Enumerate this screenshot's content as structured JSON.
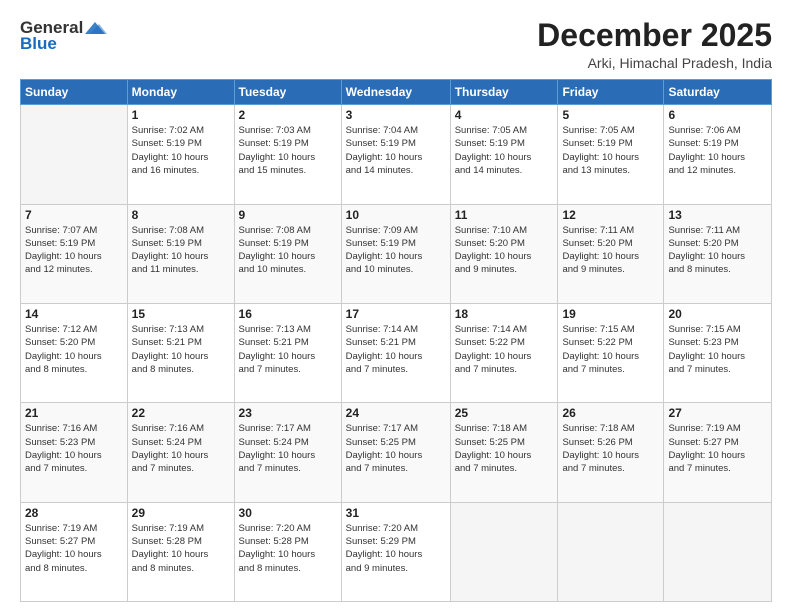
{
  "logo": {
    "general": "General",
    "blue": "Blue"
  },
  "header": {
    "month_year": "December 2025",
    "location": "Arki, Himachal Pradesh, India"
  },
  "days_of_week": [
    "Sunday",
    "Monday",
    "Tuesday",
    "Wednesday",
    "Thursday",
    "Friday",
    "Saturday"
  ],
  "weeks": [
    [
      {
        "day": "",
        "info": ""
      },
      {
        "day": "1",
        "info": "Sunrise: 7:02 AM\nSunset: 5:19 PM\nDaylight: 10 hours\nand 16 minutes."
      },
      {
        "day": "2",
        "info": "Sunrise: 7:03 AM\nSunset: 5:19 PM\nDaylight: 10 hours\nand 15 minutes."
      },
      {
        "day": "3",
        "info": "Sunrise: 7:04 AM\nSunset: 5:19 PM\nDaylight: 10 hours\nand 14 minutes."
      },
      {
        "day": "4",
        "info": "Sunrise: 7:05 AM\nSunset: 5:19 PM\nDaylight: 10 hours\nand 14 minutes."
      },
      {
        "day": "5",
        "info": "Sunrise: 7:05 AM\nSunset: 5:19 PM\nDaylight: 10 hours\nand 13 minutes."
      },
      {
        "day": "6",
        "info": "Sunrise: 7:06 AM\nSunset: 5:19 PM\nDaylight: 10 hours\nand 12 minutes."
      }
    ],
    [
      {
        "day": "7",
        "info": "Sunrise: 7:07 AM\nSunset: 5:19 PM\nDaylight: 10 hours\nand 12 minutes."
      },
      {
        "day": "8",
        "info": "Sunrise: 7:08 AM\nSunset: 5:19 PM\nDaylight: 10 hours\nand 11 minutes."
      },
      {
        "day": "9",
        "info": "Sunrise: 7:08 AM\nSunset: 5:19 PM\nDaylight: 10 hours\nand 10 minutes."
      },
      {
        "day": "10",
        "info": "Sunrise: 7:09 AM\nSunset: 5:19 PM\nDaylight: 10 hours\nand 10 minutes."
      },
      {
        "day": "11",
        "info": "Sunrise: 7:10 AM\nSunset: 5:20 PM\nDaylight: 10 hours\nand 9 minutes."
      },
      {
        "day": "12",
        "info": "Sunrise: 7:11 AM\nSunset: 5:20 PM\nDaylight: 10 hours\nand 9 minutes."
      },
      {
        "day": "13",
        "info": "Sunrise: 7:11 AM\nSunset: 5:20 PM\nDaylight: 10 hours\nand 8 minutes."
      }
    ],
    [
      {
        "day": "14",
        "info": "Sunrise: 7:12 AM\nSunset: 5:20 PM\nDaylight: 10 hours\nand 8 minutes."
      },
      {
        "day": "15",
        "info": "Sunrise: 7:13 AM\nSunset: 5:21 PM\nDaylight: 10 hours\nand 8 minutes."
      },
      {
        "day": "16",
        "info": "Sunrise: 7:13 AM\nSunset: 5:21 PM\nDaylight: 10 hours\nand 7 minutes."
      },
      {
        "day": "17",
        "info": "Sunrise: 7:14 AM\nSunset: 5:21 PM\nDaylight: 10 hours\nand 7 minutes."
      },
      {
        "day": "18",
        "info": "Sunrise: 7:14 AM\nSunset: 5:22 PM\nDaylight: 10 hours\nand 7 minutes."
      },
      {
        "day": "19",
        "info": "Sunrise: 7:15 AM\nSunset: 5:22 PM\nDaylight: 10 hours\nand 7 minutes."
      },
      {
        "day": "20",
        "info": "Sunrise: 7:15 AM\nSunset: 5:23 PM\nDaylight: 10 hours\nand 7 minutes."
      }
    ],
    [
      {
        "day": "21",
        "info": "Sunrise: 7:16 AM\nSunset: 5:23 PM\nDaylight: 10 hours\nand 7 minutes."
      },
      {
        "day": "22",
        "info": "Sunrise: 7:16 AM\nSunset: 5:24 PM\nDaylight: 10 hours\nand 7 minutes."
      },
      {
        "day": "23",
        "info": "Sunrise: 7:17 AM\nSunset: 5:24 PM\nDaylight: 10 hours\nand 7 minutes."
      },
      {
        "day": "24",
        "info": "Sunrise: 7:17 AM\nSunset: 5:25 PM\nDaylight: 10 hours\nand 7 minutes."
      },
      {
        "day": "25",
        "info": "Sunrise: 7:18 AM\nSunset: 5:25 PM\nDaylight: 10 hours\nand 7 minutes."
      },
      {
        "day": "26",
        "info": "Sunrise: 7:18 AM\nSunset: 5:26 PM\nDaylight: 10 hours\nand 7 minutes."
      },
      {
        "day": "27",
        "info": "Sunrise: 7:19 AM\nSunset: 5:27 PM\nDaylight: 10 hours\nand 7 minutes."
      }
    ],
    [
      {
        "day": "28",
        "info": "Sunrise: 7:19 AM\nSunset: 5:27 PM\nDaylight: 10 hours\nand 8 minutes."
      },
      {
        "day": "29",
        "info": "Sunrise: 7:19 AM\nSunset: 5:28 PM\nDaylight: 10 hours\nand 8 minutes."
      },
      {
        "day": "30",
        "info": "Sunrise: 7:20 AM\nSunset: 5:28 PM\nDaylight: 10 hours\nand 8 minutes."
      },
      {
        "day": "31",
        "info": "Sunrise: 7:20 AM\nSunset: 5:29 PM\nDaylight: 10 hours\nand 9 minutes."
      },
      {
        "day": "",
        "info": ""
      },
      {
        "day": "",
        "info": ""
      },
      {
        "day": "",
        "info": ""
      }
    ]
  ]
}
